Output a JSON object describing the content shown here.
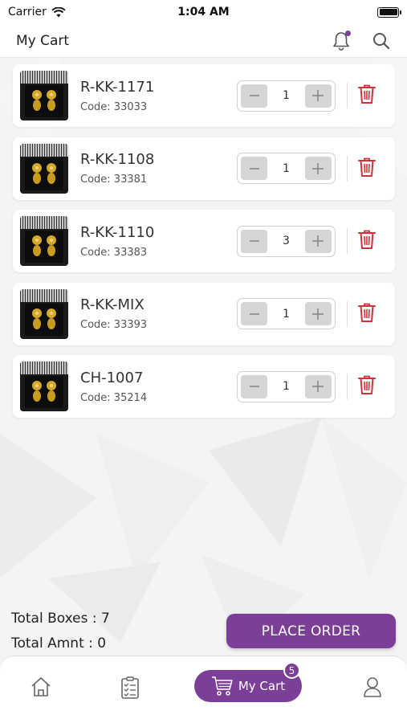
{
  "status": {
    "carrier": "Carrier",
    "time": "1:04 AM"
  },
  "header": {
    "title": "My Cart"
  },
  "cart": {
    "items": [
      {
        "name": "R-KK-1171",
        "code": "Code: 33033",
        "qty": "1"
      },
      {
        "name": "R-KK-1108",
        "code": "Code: 33381",
        "qty": "1"
      },
      {
        "name": "R-KK-1110",
        "code": "Code: 33383",
        "qty": "3"
      },
      {
        "name": "R-KK-MIX",
        "code": "Code: 33393",
        "qty": "1"
      },
      {
        "name": "CH-1007",
        "code": "Code: 35214",
        "qty": "1"
      }
    ]
  },
  "totals": {
    "boxes": "Total Boxes : 7",
    "amount": "Total Amnt : 0"
  },
  "actions": {
    "place_order": "PLACE ORDER"
  },
  "tabbar": {
    "active_label": "My Cart",
    "cart_badge": "5"
  },
  "colors": {
    "brand": "#7b3f98",
    "delete": "#d0313a"
  }
}
